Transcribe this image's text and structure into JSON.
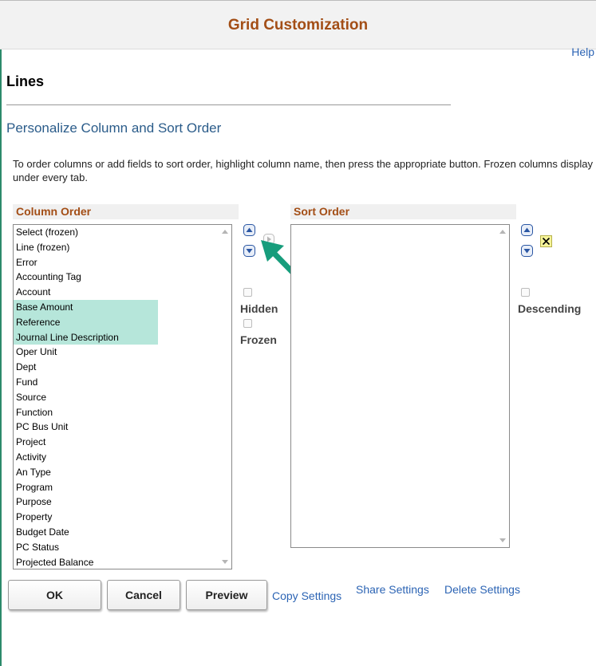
{
  "window": {
    "title": "Grid Customization",
    "help_label": "Help"
  },
  "page": {
    "heading": "Lines",
    "subheading": "Personalize Column and Sort Order",
    "instructions": "To order columns or add fields to sort order, highlight column name, then press the appropriate button. Frozen columns display under every tab."
  },
  "column_order": {
    "header": "Column Order",
    "items": [
      "Select (frozen)",
      "Line (frozen)",
      "Error",
      "Accounting Tag",
      "Account",
      "Base Amount",
      "Reference",
      "Journal Line Description",
      "Oper Unit",
      "Dept",
      "Fund",
      "Source",
      "Function",
      "PC Bus Unit",
      "Project",
      "Activity",
      "An Type",
      "Program",
      "Purpose",
      "Property",
      "Budget Date",
      "PC Status",
      "Projected Balance"
    ],
    "selected": [
      "Base Amount",
      "Reference",
      "Journal Line Description"
    ],
    "hidden_label": "Hidden",
    "frozen_label": "Frozen"
  },
  "sort_order": {
    "header": "Sort Order",
    "items": [],
    "descending_label": "Descending"
  },
  "buttons": {
    "ok": "OK",
    "cancel": "Cancel",
    "preview": "Preview"
  },
  "links": {
    "copy": "Copy Settings",
    "share": "Share Settings",
    "delete": "Delete Settings"
  },
  "icons": {
    "move_up": "up-arrow-icon",
    "move_down": "down-arrow-icon",
    "add_to_sort": "right-arrow-icon",
    "remove_from_sort": "delete-x-icon",
    "annotation": "green-arrow-icon"
  },
  "colors": {
    "title": "#a34e16",
    "link": "#2c64b4",
    "subheading": "#2b5c8a",
    "selection": "#b6e6da",
    "annotation_arrow": "#179d7c"
  }
}
